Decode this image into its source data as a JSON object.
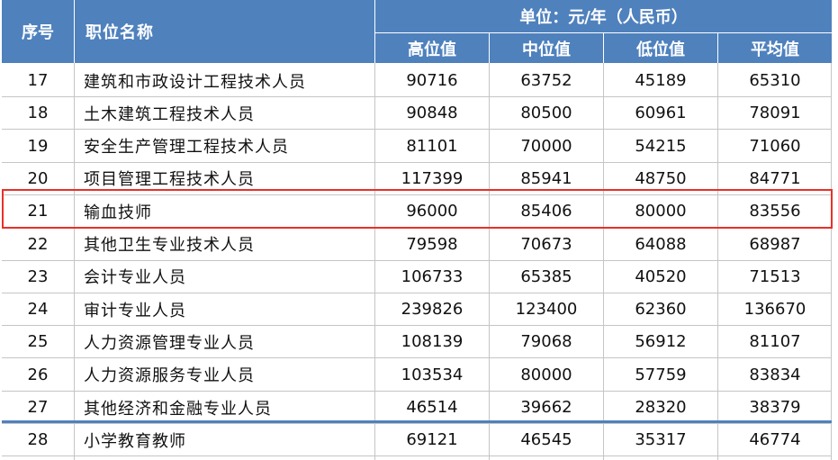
{
  "header": {
    "col_index": "序号",
    "col_name": "职位名称",
    "unit": "单位：元/年（人民币）",
    "col_high": "高位值",
    "col_mid": "中位值",
    "col_low": "低位值",
    "col_avg": "平均值"
  },
  "colors": {
    "header_bg": "#4f81bd",
    "highlight_border": "#e8302a"
  },
  "rows": [
    {
      "idx": "17",
      "name": "建筑和市政设计工程技术人员",
      "high": "90716",
      "mid": "63752",
      "low": "45189",
      "avg": "65310"
    },
    {
      "idx": "18",
      "name": "土木建筑工程技术人员",
      "high": "90848",
      "mid": "80500",
      "low": "60961",
      "avg": "78091"
    },
    {
      "idx": "19",
      "name": "安全生产管理工程技术人员",
      "high": "81101",
      "mid": "70000",
      "low": "54215",
      "avg": "71060"
    },
    {
      "idx": "20",
      "name": "项目管理工程技术人员",
      "high": "117399",
      "mid": "85941",
      "low": "48750",
      "avg": "84771"
    },
    {
      "idx": "21",
      "name": "输血技师",
      "high": "96000",
      "mid": "85406",
      "low": "80000",
      "avg": "83556"
    },
    {
      "idx": "22",
      "name": "其他卫生专业技术人员",
      "high": "79598",
      "mid": "70673",
      "low": "64088",
      "avg": "68987"
    },
    {
      "idx": "23",
      "name": "会计专业人员",
      "high": "106733",
      "mid": "65385",
      "low": "40520",
      "avg": "71513"
    },
    {
      "idx": "24",
      "name": "审计专业人员",
      "high": "239826",
      "mid": "123400",
      "low": "62360",
      "avg": "136670"
    },
    {
      "idx": "25",
      "name": "人力资源管理专业人员",
      "high": "108139",
      "mid": "79068",
      "low": "56912",
      "avg": "81107"
    },
    {
      "idx": "26",
      "name": "人力资源服务专业人员",
      "high": "103534",
      "mid": "80000",
      "low": "57759",
      "avg": "83834"
    },
    {
      "idx": "27",
      "name": "其他经济和金融专业人员",
      "high": "46514",
      "mid": "39662",
      "low": "28320",
      "avg": "38379"
    },
    {
      "idx": "28",
      "name": "小学教育教师",
      "high": "69121",
      "mid": "46545",
      "low": "35317",
      "avg": "46774"
    }
  ]
}
